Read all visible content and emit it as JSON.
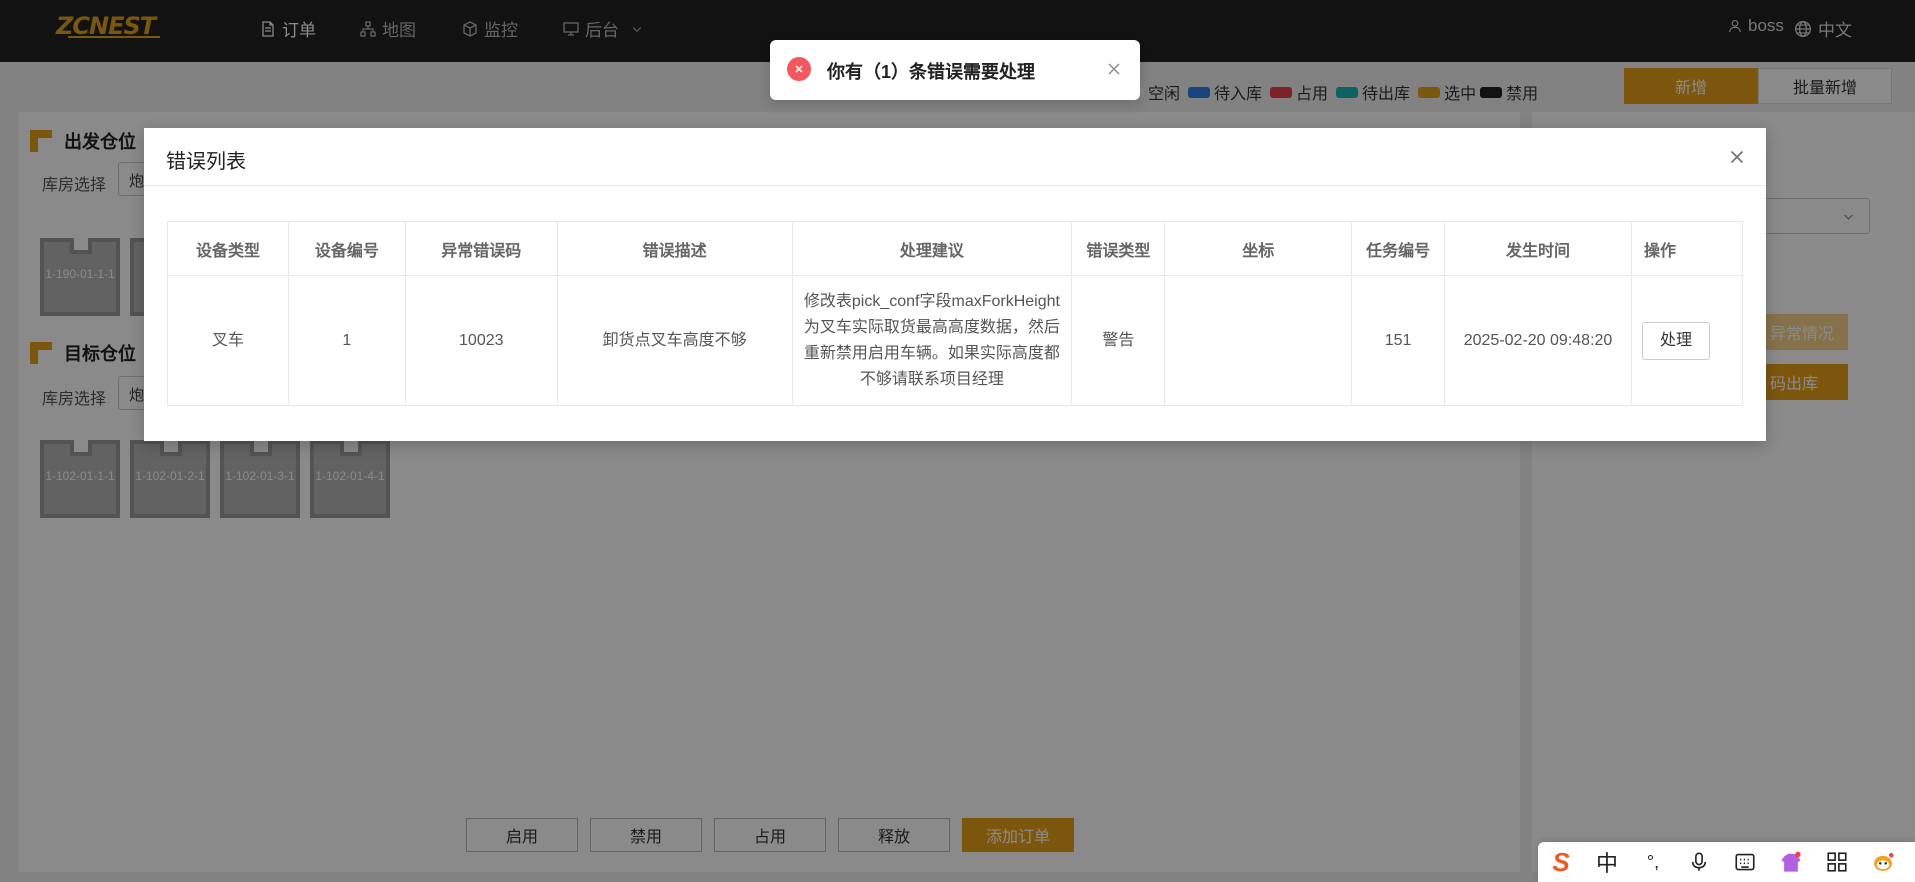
{
  "brand": {
    "logo_text": "ZCNEST"
  },
  "nav": {
    "items": [
      {
        "label": "订单",
        "icon": "document-icon",
        "active": true
      },
      {
        "label": "地图",
        "icon": "sitemap-icon",
        "active": false
      },
      {
        "label": "监控",
        "icon": "cube-icon",
        "active": false
      },
      {
        "label": "后台",
        "icon": "monitor-icon",
        "active": false
      }
    ],
    "user": "boss",
    "language": "中文"
  },
  "legend": [
    {
      "label": "空闲",
      "color": "#ffffff"
    },
    {
      "label": "待入库",
      "color": "#2f7fe8"
    },
    {
      "label": "占用",
      "color": "#e8404a"
    },
    {
      "label": "待出库",
      "color": "#1bb5b0"
    },
    {
      "label": "选中",
      "color": "#e8a01b"
    },
    {
      "label": "禁用",
      "color": "#222222"
    }
  ],
  "actions": {
    "new": "新增",
    "batch_new": "批量新增",
    "abnormal": "异常情况",
    "out": "码出库"
  },
  "source": {
    "title": "出发仓位",
    "warehouse_label": "库房选择",
    "warehouse_value": "炮",
    "slots": [
      "1-190-01-1-1"
    ]
  },
  "target": {
    "title": "目标仓位",
    "warehouse_label": "库房选择",
    "warehouse_value": "炮",
    "slots": [
      "1-102-01-1-1",
      "1-102-01-2-1",
      "1-102-01-3-1",
      "1-102-01-4-1"
    ]
  },
  "bottom_buttons": [
    "启用",
    "禁用",
    "占用",
    "释放",
    "添加订单"
  ],
  "toast": {
    "message": "你有（1）条错误需要处理"
  },
  "modal": {
    "title": "错误列表",
    "columns": [
      "设备类型",
      "设备编号",
      "异常错误码",
      "错误描述",
      "处理建议",
      "错误类型",
      "坐标",
      "任务编号",
      "发生时间",
      "操作"
    ],
    "rows": [
      {
        "device_type": "叉车",
        "device_no": "1",
        "error_code": "10023",
        "description": "卸货点叉车高度不够",
        "suggestion": "修改表pick_conf字段maxForkHeight为叉车实际取货最高高度数据，然后重新禁用启用车辆。如果实际高度都不够请联系项目经理",
        "error_type": "警告",
        "coordinate": "",
        "task_no": "151",
        "time": "2025-02-20 09:48:20",
        "action": "处理"
      }
    ]
  },
  "ime": {
    "items": [
      "S",
      "中",
      "°,",
      "mic-icon",
      "keyboard-icon",
      "skin-icon",
      "grid-icon",
      "mascot-icon"
    ]
  }
}
